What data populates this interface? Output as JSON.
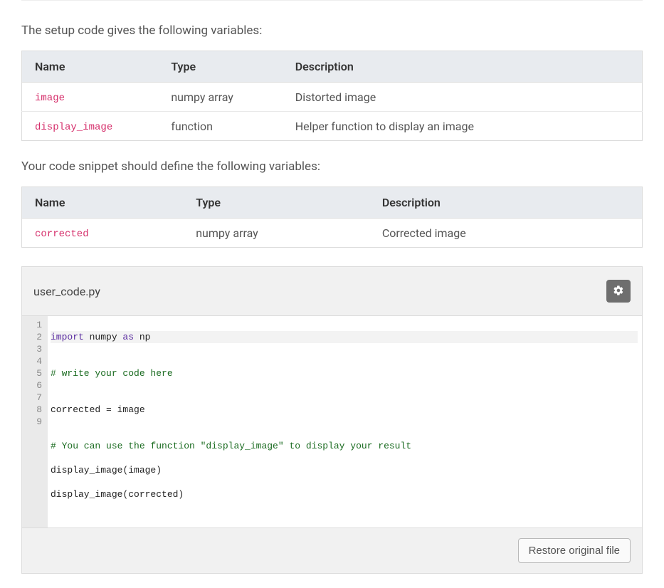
{
  "intro1": "The setup code gives the following variables:",
  "intro2": "Your code snippet should define the following variables:",
  "table1": {
    "headers": {
      "name": "Name",
      "type": "Type",
      "desc": "Description"
    },
    "rows": [
      {
        "name": "image",
        "type": "numpy array",
        "desc": "Distorted image"
      },
      {
        "name": "display_image",
        "type": "function",
        "desc": "Helper function to display an image"
      }
    ]
  },
  "table2": {
    "headers": {
      "name": "Name",
      "type": "Type",
      "desc": "Description"
    },
    "rows": [
      {
        "name": "corrected",
        "type": "numpy array",
        "desc": "Corrected image"
      }
    ]
  },
  "editor": {
    "filename": "user_code.py",
    "gutter": [
      "1",
      "2",
      "3",
      "4",
      "5",
      "6",
      "7",
      "8",
      "9"
    ],
    "code": {
      "l1a": "import",
      "l1b": " numpy ",
      "l1c": "as",
      "l1d": " np",
      "l2": "",
      "l3": "# write your code here",
      "l4": "",
      "l5": "corrected = image",
      "l6": "",
      "l7": "# You can use the function \"display_image\" to display your result",
      "l8": "display_image(image)",
      "l9": "display_image(corrected)"
    },
    "restore_label": "Restore original file"
  }
}
